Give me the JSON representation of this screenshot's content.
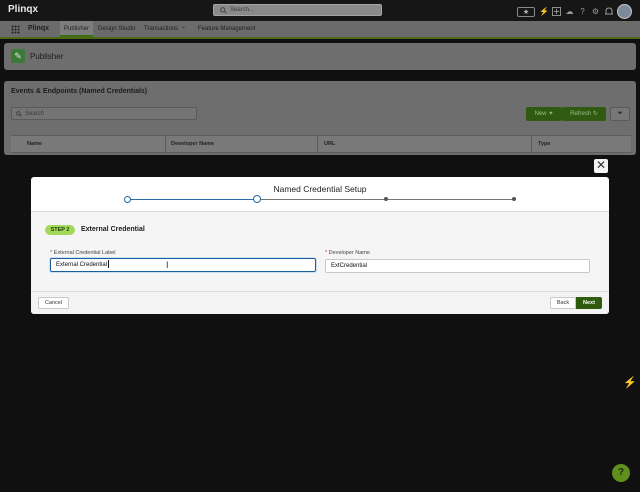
{
  "app": {
    "brand": "Plinqx",
    "search_placeholder": "Search...",
    "favorites_star": "★",
    "icons": [
      "grid-icon",
      "search-icon",
      "star-icon",
      "bolt-icon",
      "plus-icon",
      "help-icon",
      "gear-icon",
      "bell-icon",
      "avatar"
    ]
  },
  "nav": {
    "items": [
      {
        "label": "Publisher"
      },
      {
        "label": "Design Studio"
      },
      {
        "label": "Transactions"
      },
      {
        "label": "Feature Management"
      }
    ],
    "dropdown_caret": "⌄"
  },
  "page": {
    "title": "Publisher",
    "list": {
      "title": "Events & Endpoints (Named Credentials)",
      "search_placeholder": "Search",
      "new_label": "New",
      "refresh_label": "Refresh",
      "columns": [
        "Name",
        "Developer Name",
        "URL",
        "Type"
      ]
    }
  },
  "modal": {
    "title": "Named Credential Setup",
    "close_glyph": "✕",
    "step_badge": "STEP 2",
    "step_title": "External Credential",
    "fields": {
      "label_required": "*",
      "external_label": "External Credential Label",
      "external_value": "External Credential",
      "dev_label": "Developer Name",
      "dev_value": "ExtCredential"
    },
    "buttons": {
      "cancel": "Cancel",
      "back": "Back",
      "next": "Next"
    },
    "progress": {
      "total_steps": 4,
      "current_step": 2
    }
  },
  "floating": {
    "help_glyph": "?",
    "bolt_glyph": "⚡"
  },
  "colors": {
    "accent_green": "#2e5b0e",
    "step_badge": "#a2d85c",
    "progress_blue": "#1f6aa8"
  }
}
